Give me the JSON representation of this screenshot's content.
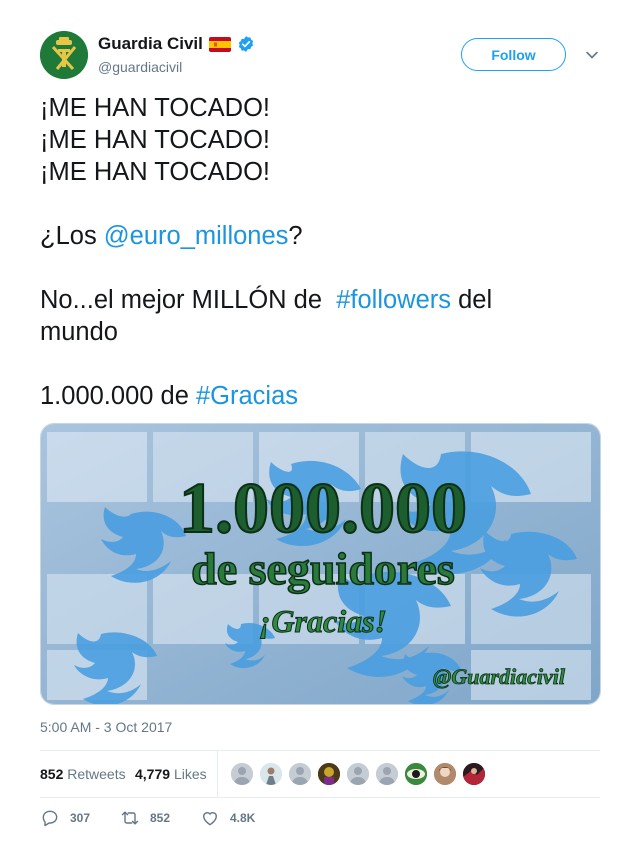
{
  "author": {
    "name": "Guardia Civil",
    "handle": "@guardiacivil",
    "flag_icon": "spain-flag-icon",
    "verified_icon": "verified-badge-icon"
  },
  "follow_label": "Follow",
  "tweet": {
    "lines": [
      "¡ME HAN TOCADO!",
      "¡ME HAN TOCADO!",
      "¡ME HAN TOCADO!"
    ],
    "question_prefix": "¿Los ",
    "question_mention": "@euro_millones",
    "question_suffix": "?",
    "line5_prefix": "No...el mejor MILLÓN de  ",
    "line5_hashtag": "#followers",
    "line5_suffix": " del",
    "line6": "mundo",
    "line7_prefix": "1.000.000 de ",
    "line7_hashtag": "#Gracias"
  },
  "media": {
    "big_number": "1.000.000",
    "subtitle": "de seguidores",
    "thanks": "¡Gracias!",
    "signature": "@Guardiacivil"
  },
  "timestamp": "5:00 AM - 3 Oct 2017",
  "stats": {
    "retweets_count": "852",
    "retweets_label": "Retweets",
    "likes_count": "4,779",
    "likes_label": "Likes"
  },
  "actions": {
    "reply_count": "307",
    "retweet_count": "852",
    "like_count": "4.8K"
  },
  "colors": {
    "accent": "#1da1f2",
    "link": "#1b95e0",
    "muted": "#657786",
    "text": "#14171a"
  }
}
